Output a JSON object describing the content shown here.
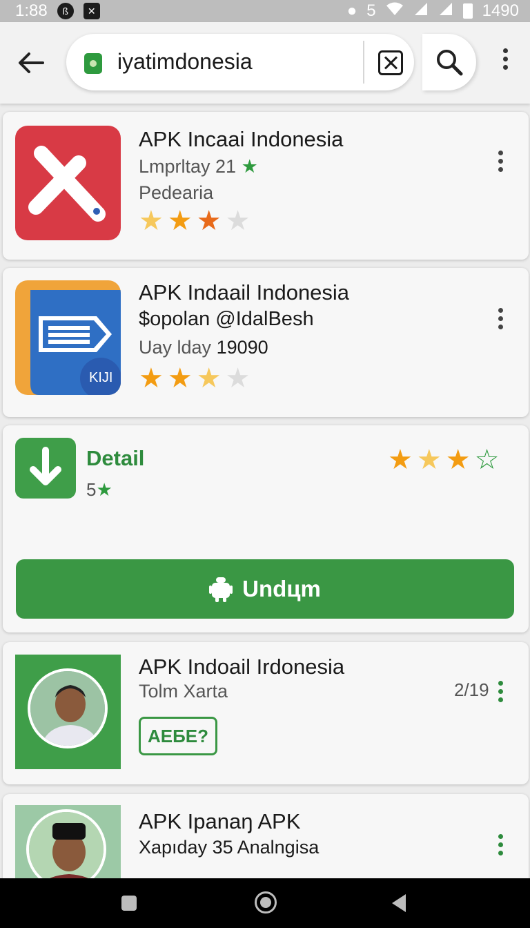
{
  "status_bar": {
    "time": "1:88",
    "right_value": "1490",
    "signal_count": "5"
  },
  "search": {
    "query": "iyatimdonesia"
  },
  "results": [
    {
      "title": "APK Incaai Indonesia",
      "subtitle": "Lmprltay 21",
      "category": "Pedearia",
      "rating_stars": 2.5
    },
    {
      "title": "APK Indaail Indonesia",
      "subtitle": "$opolan @IdalBesh",
      "meta_prefix": "Uay lday",
      "meta_number": "19090",
      "badge_text": "KIJI",
      "rating_stars": 2.5
    }
  ],
  "detail": {
    "title": "Detail",
    "rating_label": "5",
    "rating_stars": 3,
    "download_label": "Undцm"
  },
  "results_more": [
    {
      "title": "APK Indoail Irdonesia",
      "subtitle": "Tolm Xarta",
      "date": "2/19",
      "tag": "AEБE?"
    },
    {
      "title": "APK Ipanaŋ APK",
      "subtitle": "Xapıday 35 Analngisa"
    }
  ],
  "colors": {
    "accent_green": "#3a9744",
    "star_orange": "#f39c12",
    "red_icon": "#d83a45",
    "blue_icon": "#2f6fc4"
  },
  "icons": {
    "back": "arrow-left-icon",
    "clear": "close-box-icon",
    "search": "search-icon",
    "menu": "kebab-menu-icon",
    "download": "download-arrow-icon",
    "android": "android-icon"
  }
}
